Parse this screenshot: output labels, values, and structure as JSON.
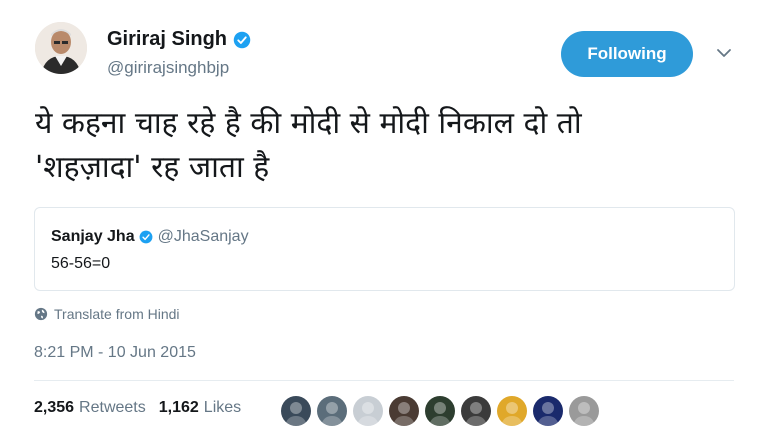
{
  "header": {
    "name": "Giriraj Singh",
    "handle": "@girirajsinghbjp",
    "follow_label": "Following",
    "verified_icon": "verified-badge-icon",
    "caret_icon": "chevron-down-icon"
  },
  "tweet": {
    "text": "ये कहना चाह रहे है की मोदी से मोदी निकाल दो तो\n'शहज़ादा' रह जाता है"
  },
  "quote": {
    "name": "Sanjay Jha",
    "handle": "@JhaSanjay",
    "text": "56-56=0"
  },
  "translate": {
    "label": "Translate from Hindi",
    "icon": "globe-icon"
  },
  "timestamp": "8:21 PM - 10 Jun 2015",
  "stats": {
    "retweets_count": "2,356",
    "retweets_label": "Retweets",
    "likes_count": "1,162",
    "likes_label": "Likes"
  },
  "likers": [
    {
      "name": "liker-avatar-1",
      "color": "#3a4a5a"
    },
    {
      "name": "liker-avatar-2",
      "color": "#5b6d7a"
    },
    {
      "name": "liker-avatar-3",
      "color": "#c8ced4"
    },
    {
      "name": "liker-avatar-4",
      "color": "#4a3b33"
    },
    {
      "name": "liker-avatar-5",
      "color": "#2d3e2f"
    },
    {
      "name": "liker-avatar-6",
      "color": "#3b3b3b"
    },
    {
      "name": "liker-avatar-7",
      "color": "#e0a82a"
    },
    {
      "name": "liker-avatar-8",
      "color": "#1a2a6c"
    },
    {
      "name": "liker-avatar-9",
      "color": "#9a9a9a"
    }
  ],
  "colors": {
    "accent": "#1da1f2",
    "secondary_text": "#657786"
  }
}
